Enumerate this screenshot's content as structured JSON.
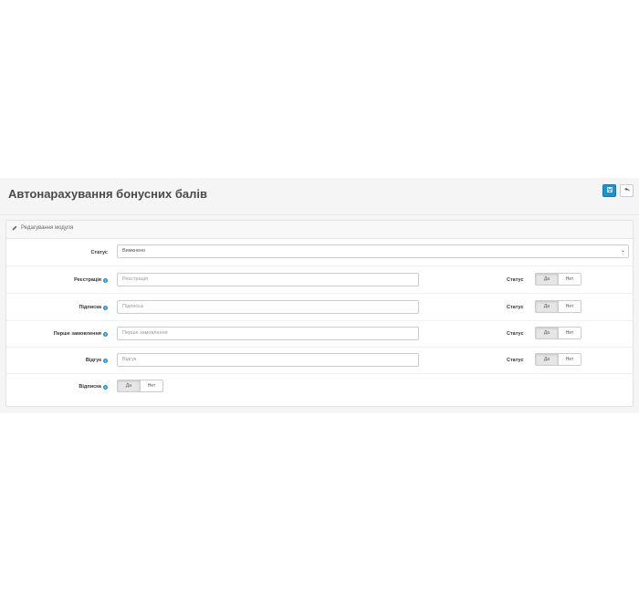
{
  "header": {
    "title": "Автонарахування бонусних балів",
    "save_icon": "save-icon",
    "back_icon": "reply-icon"
  },
  "panel": {
    "title": "Редагування модуля",
    "icon": "pencil-icon"
  },
  "form": {
    "status": {
      "label": "Статус",
      "value": "Вимкнено"
    },
    "rows": [
      {
        "label": "Реєстрація",
        "placeholder": "Реєстрація",
        "status_label": "Статус",
        "yes": "Да",
        "no": "Нет"
      },
      {
        "label": "Підписка",
        "placeholder": "Підписка",
        "status_label": "Статус",
        "yes": "Да",
        "no": "Нет"
      },
      {
        "label": "Перше замовлення",
        "placeholder": "Перше замовлення",
        "status_label": "Статус",
        "yes": "Да",
        "no": "Нет"
      },
      {
        "label": "Відгук",
        "placeholder": "Відгук",
        "status_label": "Статус",
        "yes": "Да",
        "no": "Нет"
      }
    ],
    "unsubscribe": {
      "label": "Відписка",
      "yes": "Да",
      "no": "Нет"
    }
  },
  "colors": {
    "primary": "#1e91cf",
    "background": "#f5f5f5"
  }
}
